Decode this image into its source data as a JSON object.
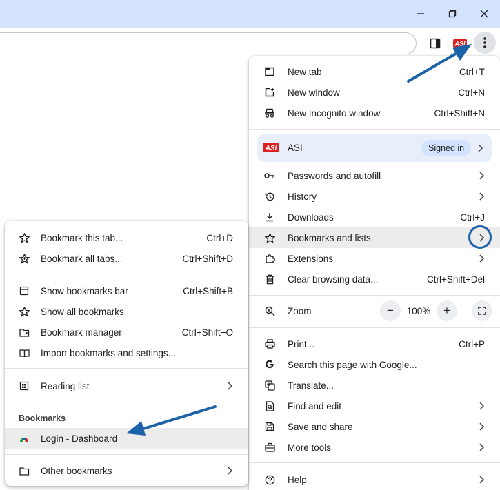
{
  "window": {
    "controls": [
      {
        "name": "minimize-button",
        "icon": "minimize-icon"
      },
      {
        "name": "restore-button",
        "icon": "restore-icon"
      },
      {
        "name": "close-window-button",
        "icon": "close-icon"
      }
    ]
  },
  "toolbar": {
    "extension_logo": "ASI",
    "accent_colors": {
      "arrow": "#1b62a8",
      "asi_red": "#e02020",
      "highlight": "#ececec",
      "profile_bg": "#e8eefa"
    }
  },
  "main_menu": {
    "top_items": [
      {
        "label": "New tab",
        "shortcut": "Ctrl+T",
        "icon": "new-tab-icon"
      },
      {
        "label": "New window",
        "shortcut": "Ctrl+N",
        "icon": "new-window-icon"
      },
      {
        "label": "New Incognito window",
        "shortcut": "Ctrl+Shift+N",
        "icon": "incognito-icon"
      }
    ],
    "profile": {
      "name": "ASI",
      "status": "Signed in"
    },
    "mid_items": [
      {
        "label": "Passwords and autofill",
        "icon": "key-icon",
        "submenu": true
      },
      {
        "label": "History",
        "icon": "history-icon",
        "submenu": true
      },
      {
        "label": "Downloads",
        "shortcut": "Ctrl+J",
        "icon": "download-icon"
      },
      {
        "label": "Bookmarks and lists",
        "icon": "star-icon",
        "submenu": true
      },
      {
        "label": "Extensions",
        "icon": "puzzle-icon",
        "submenu": true
      },
      {
        "label": "Clear browsing data...",
        "shortcut": "Ctrl+Shift+Del",
        "icon": "trash-icon"
      }
    ],
    "zoom": {
      "label": "Zoom",
      "value": "100%",
      "minus": "−",
      "plus": "+"
    },
    "bottom_items": [
      {
        "label": "Print...",
        "shortcut": "Ctrl+P",
        "icon": "print-icon"
      },
      {
        "label": "Search this page with Google...",
        "icon": "google-icon"
      },
      {
        "label": "Translate...",
        "icon": "translate-icon"
      },
      {
        "label": "Find and edit",
        "icon": "find-icon",
        "submenu": true
      },
      {
        "label": "Save and share",
        "icon": "save-icon",
        "submenu": true
      },
      {
        "label": "More tools",
        "icon": "toolbox-icon",
        "submenu": true
      },
      {
        "label": "Help",
        "icon": "help-icon",
        "submenu": true
      }
    ]
  },
  "bookmarks_menu": {
    "items_a": [
      {
        "label": "Bookmark this tab...",
        "shortcut": "Ctrl+D",
        "icon": "star-outline-icon"
      },
      {
        "label": "Bookmark all tabs...",
        "shortcut": "Ctrl+Shift+D",
        "icon": "star-plus-icon"
      }
    ],
    "items_b": [
      {
        "label": "Show bookmarks bar",
        "shortcut": "Ctrl+Shift+B",
        "icon": "bookmarks-bar-icon"
      },
      {
        "label": "Show all bookmarks",
        "icon": "star-outline-icon"
      },
      {
        "label": "Bookmark manager",
        "shortcut": "Ctrl+Shift+O",
        "icon": "folder-link-icon"
      },
      {
        "label": "Import bookmarks and settings...",
        "icon": "import-icon"
      }
    ],
    "reading_list": {
      "label": "Reading list",
      "icon": "reading-list-icon"
    },
    "section_title": "Bookmarks",
    "bookmark": {
      "label": "Login - Dashboard",
      "icon": "dashboard-favicon-icon"
    },
    "other": {
      "label": "Other bookmarks",
      "icon": "folder-icon"
    }
  }
}
